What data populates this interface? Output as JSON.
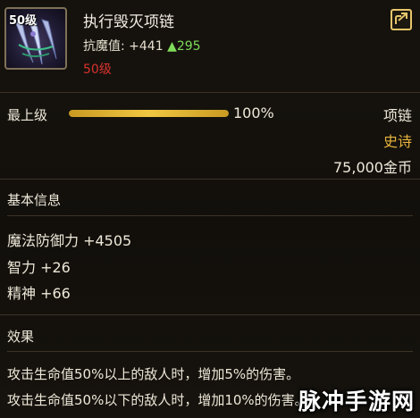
{
  "item": {
    "level_badge": "50级",
    "name": "执行毁灭项链",
    "stat_label": "抗魔值:",
    "stat_value": "+441",
    "stat_up_arrow": "▲",
    "stat_up": "295",
    "required_level": "50级"
  },
  "enhance": {
    "label": "最上级",
    "progress_percent": 100,
    "progress_text": "100%"
  },
  "meta": {
    "type": "项链",
    "rarity": "史诗",
    "price": "75,000金币"
  },
  "basic_info": {
    "title": "基本信息",
    "attrs": [
      "魔法防御力 +4505",
      "智力 +26",
      "精神 +66"
    ]
  },
  "effects": {
    "title": "效果",
    "lines": [
      "攻击生命值50%以上的敌人时，增加5%的伤害。",
      "攻击生命值50%以下的敌人时，增加10%的伤害。"
    ]
  },
  "watermark": "脉冲手游网",
  "colors": {
    "rarity": "#e7b33d",
    "required_level": "#d8322d",
    "stat_up": "#7fdc5a",
    "bar": "#f0c742"
  },
  "icons": {
    "item_icon": "claw-necklace-icon",
    "share": "share-icon"
  }
}
